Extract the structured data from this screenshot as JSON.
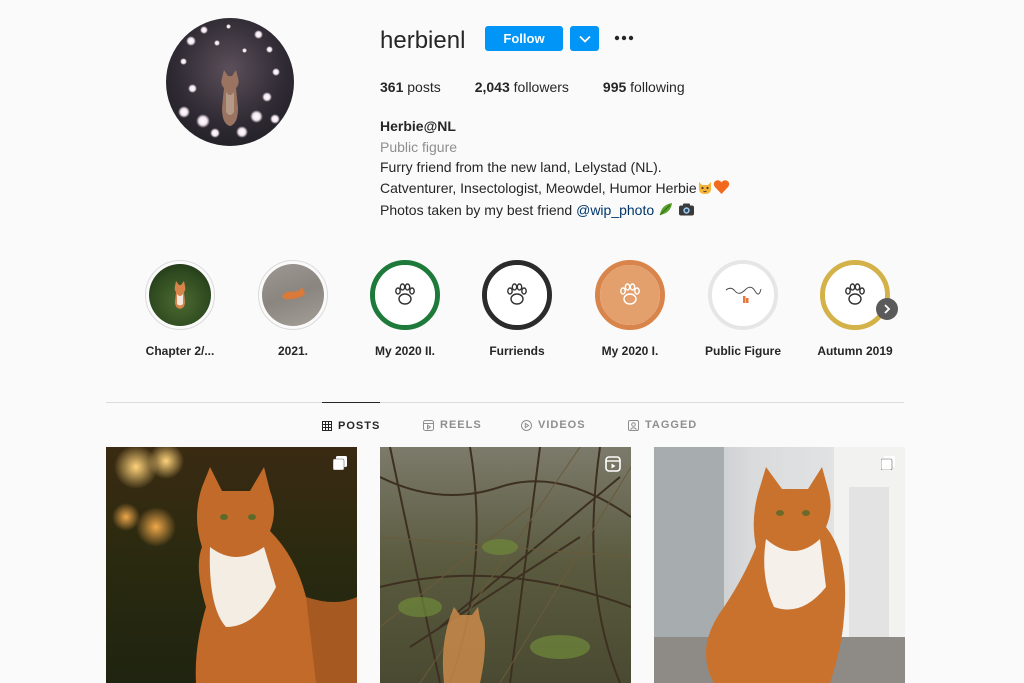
{
  "profile": {
    "username": "herbienl",
    "follow_label": "Follow",
    "stats": {
      "posts_count": "361",
      "posts_label": "posts",
      "followers_count": "2,043",
      "followers_label": "followers",
      "following_count": "995",
      "following_label": "following"
    },
    "bio": {
      "name": "Herbie@NL",
      "category": "Public figure",
      "line1": "Furry friend from the new land, Lelystad (NL).",
      "line2": "Catventurer, Insectologist, Meowdel, Humor Herbie",
      "line3_prefix": "Photos taken by my best friend ",
      "mention": "@wip_photo"
    }
  },
  "highlights": [
    {
      "label": "Chapter 2/...",
      "cover": "photo-cat-forest",
      "ring_color": "#dbdbdb"
    },
    {
      "label": "2021.",
      "cover": "photo-cat-road",
      "ring_color": "#dbdbdb"
    },
    {
      "label": "My 2020 II.",
      "cover": "paw-logo",
      "ring_color": "#1e7a3a"
    },
    {
      "label": "Furriends",
      "cover": "paw-logo",
      "ring_color": "#2b2b2b"
    },
    {
      "label": "My 2020 I.",
      "cover": "paw-logo",
      "ring_color": "#d9844a"
    },
    {
      "label": "Public Figure",
      "cover": "text-logo",
      "ring_color": "#e6e6e6"
    },
    {
      "label": "Autumn 2019",
      "cover": "paw-logo",
      "ring_color": "#d4b24a"
    }
  ],
  "tabs": [
    {
      "label": "POSTS",
      "icon": "grid-icon",
      "active": true
    },
    {
      "label": "REELS",
      "icon": "reels-icon",
      "active": false
    },
    {
      "label": "VIDEOS",
      "icon": "play-icon",
      "active": false
    },
    {
      "label": "TAGGED",
      "icon": "tag-icon",
      "active": false
    }
  ],
  "posts": [
    {
      "subject": "orange tabby cat sitting, bokeh lights",
      "corner_icon": "carousel-icon"
    },
    {
      "subject": "cat hidden in bushes",
      "corner_icon": "reel-icon"
    },
    {
      "subject": "orange tabby cat sitting indoors",
      "corner_icon": "carousel-icon"
    }
  ],
  "colors": {
    "accent": "#0095f6",
    "text": "#262626",
    "muted": "#8e8e8e",
    "link": "#00376b",
    "background": "#fafafa",
    "border": "#dbdbdb"
  }
}
